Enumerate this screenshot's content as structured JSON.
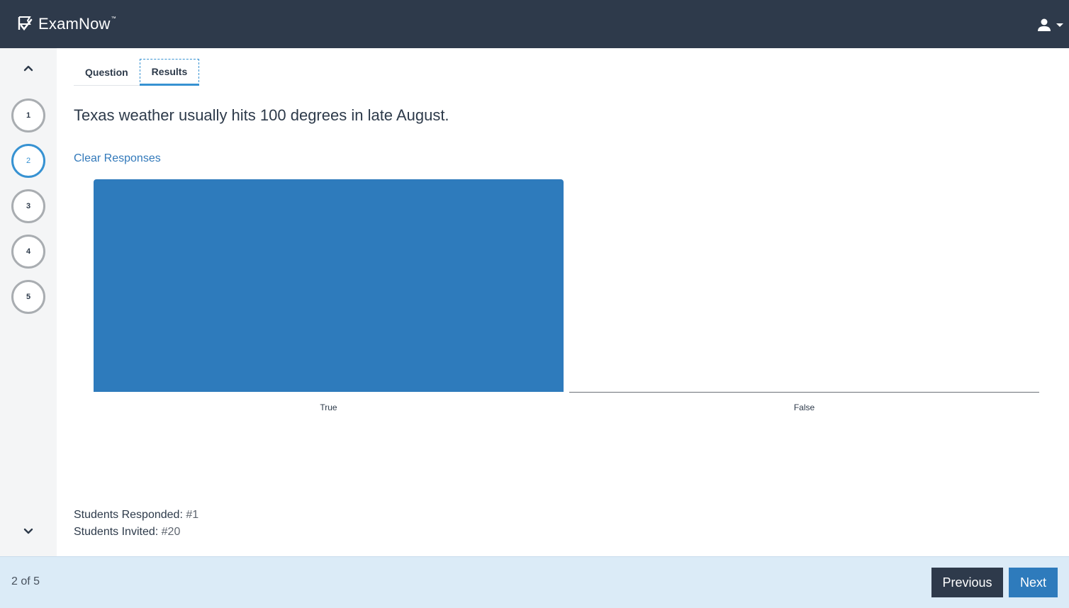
{
  "header": {
    "app_name": "ExamNow",
    "trademark": "™",
    "logo_icon": "check-flag-icon",
    "user_icon": "user-icon"
  },
  "sidebar": {
    "up_icon": "chevron-up-icon",
    "down_icon": "chevron-down-icon",
    "questions": [
      "1",
      "2",
      "3",
      "4",
      "5"
    ],
    "active_question": "2"
  },
  "tabs": [
    {
      "label": "Question",
      "active": false
    },
    {
      "label": "Results",
      "active": true
    }
  ],
  "question": {
    "text": "Texas weather usually hits 100 degrees in late August."
  },
  "actions": {
    "clear_label": "Clear Responses"
  },
  "chart_data": {
    "type": "bar",
    "categories": [
      "True",
      "False"
    ],
    "values": [
      1,
      0
    ],
    "ylim": [
      0,
      1
    ],
    "grid": false,
    "colors": {
      "bar": "#2e7bbc"
    }
  },
  "stats": {
    "responded_label": "Students Responded:",
    "responded_value": "#1",
    "invited_label": "Students Invited:",
    "invited_value": "#20"
  },
  "footer": {
    "page_count": "2 of 5",
    "previous_label": "Previous",
    "next_label": "Next"
  },
  "colors": {
    "header_bg": "#2e3a4b",
    "accent": "#3792d2",
    "link": "#3279ba",
    "footer_bg": "#dbebf7"
  }
}
